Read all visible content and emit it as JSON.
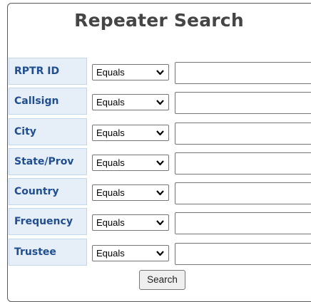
{
  "title": "Repeater Search",
  "operator_default": "Equals",
  "rows": [
    {
      "label": "RPTR ID",
      "operator": "Equals",
      "value": ""
    },
    {
      "label": "Callsign",
      "operator": "Equals",
      "value": ""
    },
    {
      "label": "City",
      "operator": "Equals",
      "value": ""
    },
    {
      "label": "State/Prov",
      "operator": "Equals",
      "value": ""
    },
    {
      "label": "Country",
      "operator": "Equals",
      "value": ""
    },
    {
      "label": "Frequency",
      "operator": "Equals",
      "value": ""
    },
    {
      "label": "Trustee",
      "operator": "Equals",
      "value": ""
    }
  ],
  "search_button": "Search",
  "colors": {
    "label_bg": "#e6eef8",
    "label_text": "#1f4e91",
    "title_text": "#454545"
  },
  "icons": {
    "dropdown": "chevron-down-icon"
  }
}
